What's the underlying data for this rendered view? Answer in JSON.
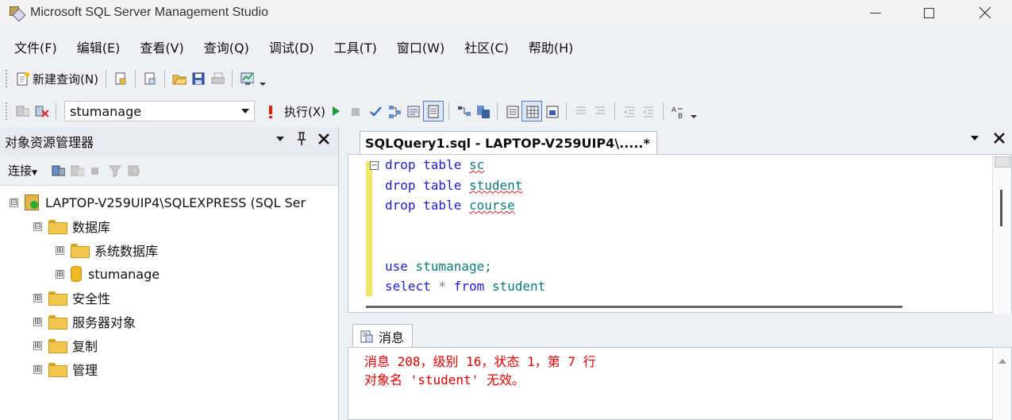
{
  "window": {
    "title": "Microsoft SQL Server Management Studio"
  },
  "menu": [
    "文件(F)",
    "编辑(E)",
    "查看(V)",
    "查询(Q)",
    "调试(D)",
    "工具(T)",
    "窗口(W)",
    "社区(C)",
    "帮助(H)"
  ],
  "toolbar1": {
    "new_query_label": "新建查询(N)"
  },
  "toolbar2": {
    "database_value": "stumanage",
    "execute_label": "执行(X)"
  },
  "object_explorer": {
    "title": "对象资源管理器",
    "connect_label": "连接",
    "server_node": "LAPTOP-V259UIP4\\SQLEXPRESS (SQL Ser",
    "nodes": [
      {
        "label": "数据库",
        "expander": "⊟"
      },
      {
        "label": "系统数据库",
        "expander": "⊞"
      },
      {
        "label": "stumanage",
        "expander": "⊞"
      },
      {
        "label": "安全性",
        "expander": "⊞"
      },
      {
        "label": "服务器对象",
        "expander": "⊞"
      },
      {
        "label": "复制",
        "expander": "⊞"
      },
      {
        "label": "管理",
        "expander": "⊞"
      }
    ],
    "server_expander": "⊟"
  },
  "editor": {
    "tab_title": "SQLQuery1.sql - LAPTOP-V259UIP4\\.....*",
    "lines": [
      {
        "kw": "drop table ",
        "id": "sc"
      },
      {
        "kw": "drop table ",
        "id": "student"
      },
      {
        "kw": "drop table ",
        "id": "course"
      },
      {
        "kw": "",
        "id": ""
      },
      {
        "kw": "",
        "id": ""
      },
      {
        "kw": "use ",
        "id": "stumanage;"
      },
      {
        "kw": "select ",
        "star": "* ",
        "kw2": "from ",
        "id": "student"
      }
    ]
  },
  "messages": {
    "tab_label": "消息",
    "lines": [
      "消息 208，级别 16，状态 1，第 7 行",
      "对象名 'student' 无效。"
    ]
  },
  "colors": {
    "keyword": "#2020d0",
    "identifier": "#0d7a7a",
    "error": "#e00000"
  }
}
